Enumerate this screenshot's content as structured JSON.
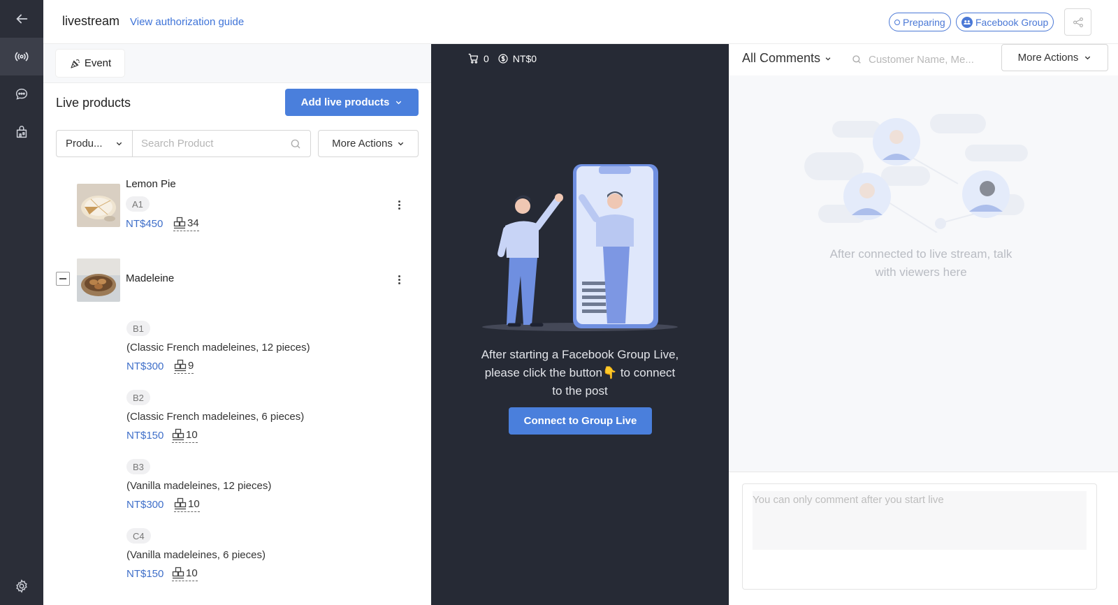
{
  "rail": {
    "items": [
      {
        "name": "back",
        "icon": "arrow-left-icon"
      },
      {
        "name": "live",
        "icon": "broadcast-icon"
      },
      {
        "name": "messages",
        "icon": "chat-bubble-icon"
      },
      {
        "name": "shop",
        "icon": "shop-icon"
      },
      {
        "name": "settings",
        "icon": "gear-icon"
      }
    ]
  },
  "header": {
    "title": "livestream",
    "guide_link": "View authorization guide",
    "status_pill": "Preparing",
    "platform_pill": "Facebook Group",
    "share_icon": "share-icon"
  },
  "products": {
    "event_tab": "Event",
    "section_title": "Live products",
    "add_button": "Add live products",
    "filter_select": "Produ...",
    "search_placeholder": "Search Product",
    "more_actions": "More Actions",
    "items": [
      {
        "name": "Lemon Pie",
        "code": "A1",
        "price": "NT$450",
        "stock": "34"
      },
      {
        "name": "Madeleine",
        "variants": [
          {
            "code": "B1",
            "desc": "(Classic French madeleines, 12 pieces)",
            "price": "NT$300",
            "stock": "9"
          },
          {
            "code": "B2",
            "desc": "(Classic French madeleines, 6 pieces)",
            "price": "NT$150",
            "stock": "10"
          },
          {
            "code": "B3",
            "desc": "(Vanilla madeleines, 12 pieces)",
            "price": "NT$300",
            "stock": "10"
          },
          {
            "code": "C4",
            "desc": "(Vanilla madeleines, 6 pieces)",
            "price": "NT$150",
            "stock": "10"
          }
        ]
      }
    ]
  },
  "center": {
    "cart_count": "0",
    "revenue": "NT$0",
    "message_line1": "After starting a Facebook Group Live,",
    "message_line2_a": "please click the button",
    "message_line2_b": " to connect",
    "message_line3": "to the post",
    "connect_button": "Connect to Group Live"
  },
  "comments": {
    "filter": "All Comments",
    "search_placeholder": "Customer Name, Me...",
    "more_actions": "More Actions",
    "empty_line1": "After connected to live stream, talk",
    "empty_line2": "with viewers here",
    "input_placeholder": "You can only comment after you start live"
  },
  "colors": {
    "accent": "#4a7fdc",
    "rail_bg": "#2b2e38",
    "center_bg": "#262a35",
    "price": "#3f6fc9"
  }
}
